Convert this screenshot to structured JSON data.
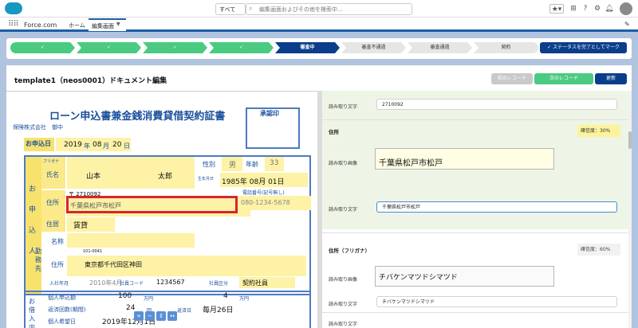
{
  "header": {
    "search_scope": "すべて",
    "search_placeholder": "編集画面およびその他を検索中..."
  },
  "nav": {
    "app_name": "Force.com",
    "home": "ホーム",
    "tab": "編集画面"
  },
  "path": {
    "stages": [
      {
        "label": "",
        "state": "done"
      },
      {
        "label": "",
        "state": "done"
      },
      {
        "label": "",
        "state": "done"
      },
      {
        "label": "",
        "state": "done"
      },
      {
        "label": "審査中",
        "state": "current"
      },
      {
        "label": "審査不通過",
        "state": "todo"
      },
      {
        "label": "審査通過",
        "state": "todo"
      },
      {
        "label": "契約",
        "state": "todo"
      }
    ],
    "complete_button": "✓ ステータスを完了としてマーク"
  },
  "page": {
    "title": "template1（neos0001）ドキュメント編集",
    "prev_button": "前のレコード",
    "next_button": "次のレコード",
    "refresh_button": "更新"
  },
  "form": {
    "top_field_label": "読み取り文字",
    "top_field_value": "2710092",
    "address": {
      "title": "住所",
      "confidence": "確信度：30%",
      "image_label": "読み取り画像",
      "image_text": "千葉県松戸市松戸",
      "text_label": "読み取り文字",
      "text_value": "千葉県松戸市松戸"
    },
    "address_kana": {
      "title": "住所（フリガナ）",
      "confidence": "確信度：60%",
      "image_label": "読み取り画像",
      "image_text": "チバケンマツドシマツド",
      "text_label": "読み取り文字",
      "text_value": "チバケンマツドシマツド"
    },
    "bottom_field_label": "読み取り文字"
  },
  "document": {
    "title": "ローン申込書兼金銭消費貸借契約証書",
    "stamp_label": "承認印",
    "addressee": "保険株式会社　御中",
    "date_label": "お申込日",
    "date": {
      "year": "2019",
      "y_unit": "年",
      "month": "08",
      "m_unit": "月",
      "day": "20",
      "d_unit": "日"
    },
    "side_label": "お申込人",
    "name_label": "氏名",
    "furigana_label": "フリガナ",
    "surname": "山本",
    "given": "太郎",
    "gender_label": "性別",
    "gender": "男",
    "age_label": "年齢",
    "age": "33",
    "dob_label": "生年月日",
    "dob": "1985年 08月 01日",
    "address_label": "住所",
    "postal_code": "〒 2710092",
    "address_text": "千葉県松戸市松戸",
    "phone_label": "電話番号(記号無し)",
    "phone": "080-1234-5678",
    "residence_label": "住居",
    "residence": "賃貸",
    "employer_label": "勤務先",
    "company_name_label": "名称",
    "company_address_label": "住所",
    "company_postal": "101-0041",
    "company_address": "東京都千代田区神田",
    "join_date_label": "入社年月",
    "join_date": "2010年4月",
    "employee_code_label": "社員コード",
    "employee_code": "1234567",
    "employee_type_label": "社員区分",
    "employee_type": "契約社員",
    "loan_section_label": "お借入内容",
    "loan_amount_label": "個人申込額",
    "loan_amount": "100",
    "loan_unit": "万円",
    "repay_count_label": "返済回数(期間)",
    "repay_count": "24",
    "repay_unit": "回",
    "desired_date_label": "個人希望日",
    "desired_date": "2019年12月1日",
    "monthly_unit": "万円",
    "monthly_amount": "4",
    "monthly_day": "毎月26日",
    "repay_day_label": "返済日"
  },
  "colors": {
    "accent": "#0b3e8a",
    "done": "#4bca81",
    "highlight_red": "#d9232f",
    "confidence_low": "#fdf39c",
    "row_background": "#eef5e6"
  }
}
